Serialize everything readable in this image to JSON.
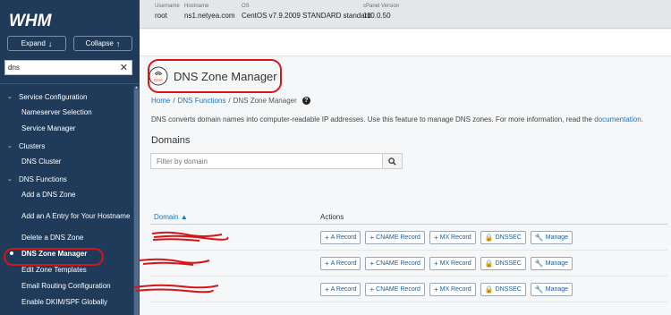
{
  "sidebar": {
    "logo": "WHM",
    "expand_label": "Expand",
    "collapse_label": "Collapse",
    "search_value": "dns",
    "sections": [
      {
        "title": "Service Configuration",
        "items": [
          "Nameserver Selection",
          "Service Manager"
        ]
      },
      {
        "title": "Clusters",
        "items": [
          "DNS Cluster"
        ]
      },
      {
        "title": "DNS Functions",
        "items": [
          "Add a DNS Zone",
          "Add an A Entry for Your Hostname",
          "Delete a DNS Zone",
          "DNS Zone Manager",
          "Edit Zone Templates",
          "Email Routing Configuration",
          "Enable DKIM/SPF Globally"
        ]
      }
    ]
  },
  "topbar": {
    "username_label": "Username",
    "username": "root",
    "hostname_label": "Hostname",
    "hostname": "ns1.netyea.com",
    "os_label": "OS",
    "os": "CentOS v7.9.2009 STANDARD standard",
    "version_label": "cPanel Version",
    "version": "110.0.50"
  },
  "page": {
    "title": "DNS Zone Manager",
    "icon_text": "DNS",
    "breadcrumb": [
      "Home",
      "DNS Functions",
      "DNS Zone Manager"
    ],
    "description": "DNS converts domain names into computer-readable IP addresses. Use this feature to manage DNS zones. For more information, read the",
    "description_link": "documentation",
    "description_end": ".",
    "section_title": "Domains",
    "filter_placeholder": "Filter by domain"
  },
  "table": {
    "col_domain": "Domain",
    "col_actions": "Actions",
    "action_labels": [
      "A Record",
      "CNAME Record",
      "MX Record",
      "DNSSEC",
      "Manage"
    ],
    "rows": 3
  },
  "colors": {
    "sidebar": "#1f3b59",
    "annotation": "#d4161b",
    "link": "#1a73b9"
  }
}
